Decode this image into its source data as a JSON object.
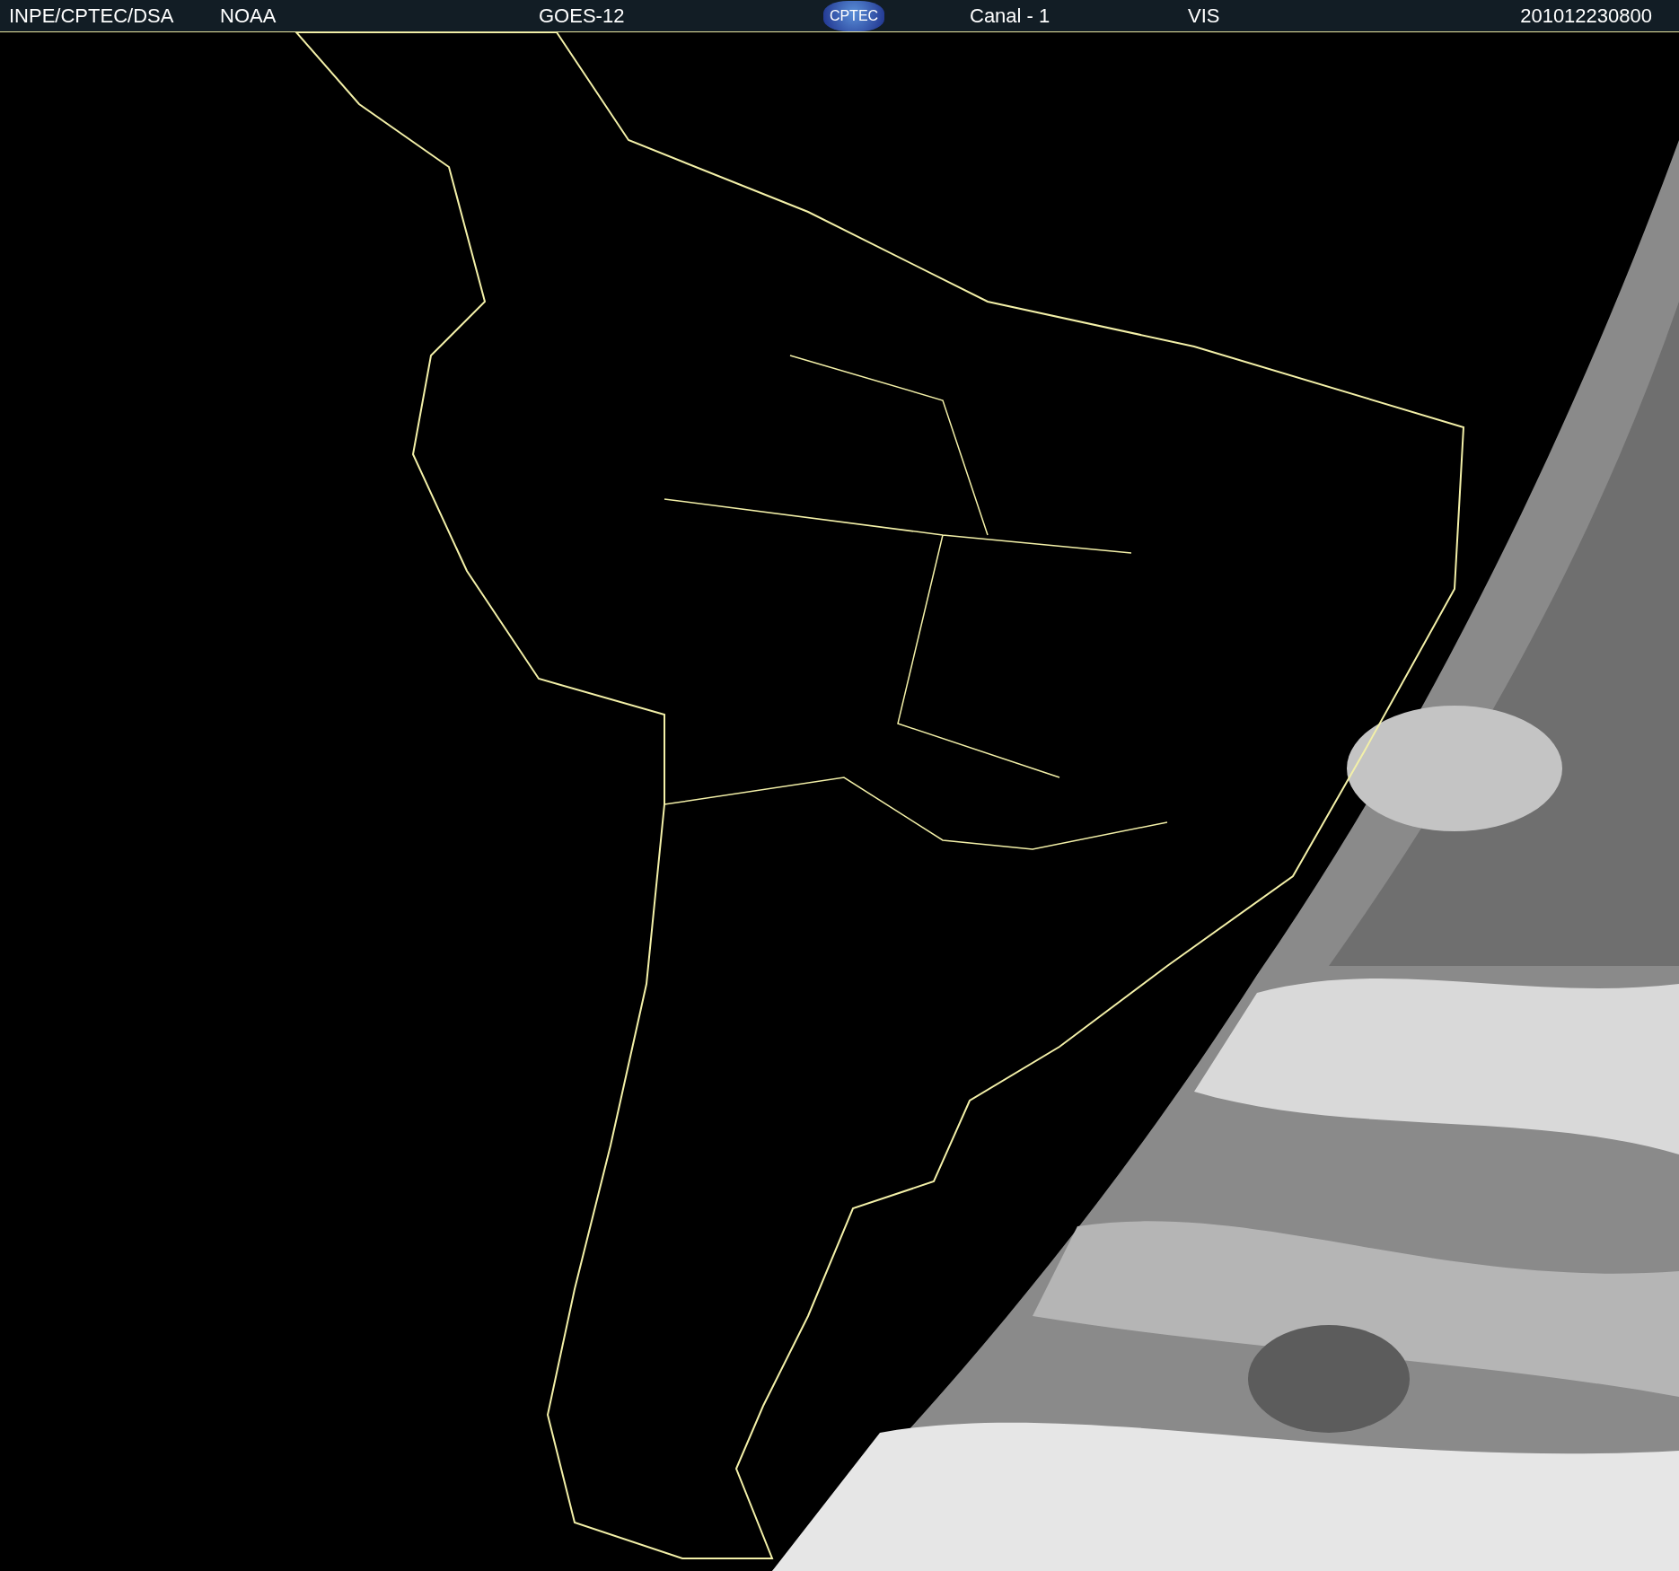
{
  "header": {
    "source": "INPE/CPTEC/DSA",
    "agency": "NOAA",
    "satellite": "GOES-12",
    "logo": "CPTEC",
    "channel": "Canal - 1",
    "band": "VIS",
    "timestamp": "201012230800"
  }
}
